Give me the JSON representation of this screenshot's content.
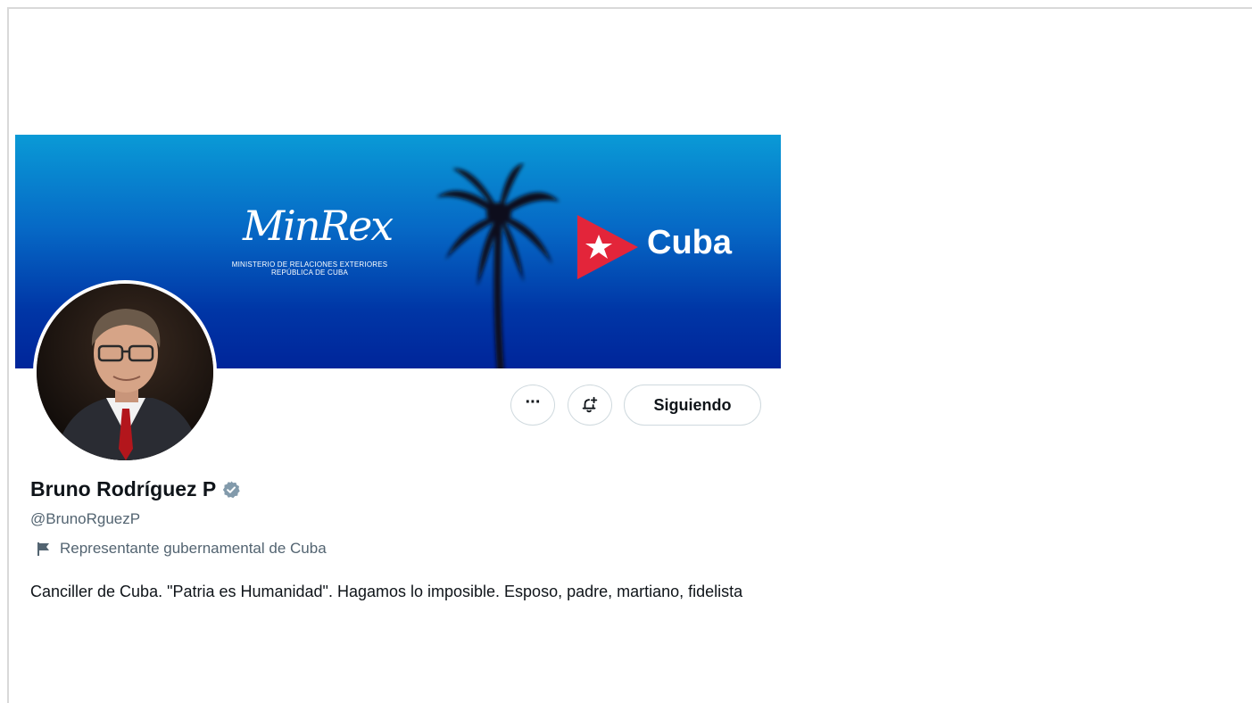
{
  "banner": {
    "minrex_title": "MinRex",
    "minrex_line1": "MINISTERIO DE RELACIONES EXTERIORES",
    "minrex_line2": "REPÚBLICA DE CUBA",
    "country_word": "Cuba"
  },
  "actions": {
    "more_icon": "ellipsis-icon",
    "more_label": "···",
    "notify_icon": "bell-plus-icon",
    "follow_label": "Siguiendo"
  },
  "profile": {
    "display_name": "Bruno Rodríguez P",
    "verified_icon": "verified-badge-icon",
    "handle": "@BrunoRguezP",
    "affiliation_icon": "flag-icon",
    "affiliation": "Representante gubernamental de Cuba",
    "bio": "Canciller de Cuba. \"Patria es Humanidad\". Hagamos lo imposible. Esposo, padre, martiano, fidelista"
  },
  "colors": {
    "banner_top": "#0a9ad6",
    "banner_bottom": "#00259a",
    "cuba_red": "#e3253a",
    "verified_gray": "#829aab",
    "secondary_text": "#536471"
  }
}
